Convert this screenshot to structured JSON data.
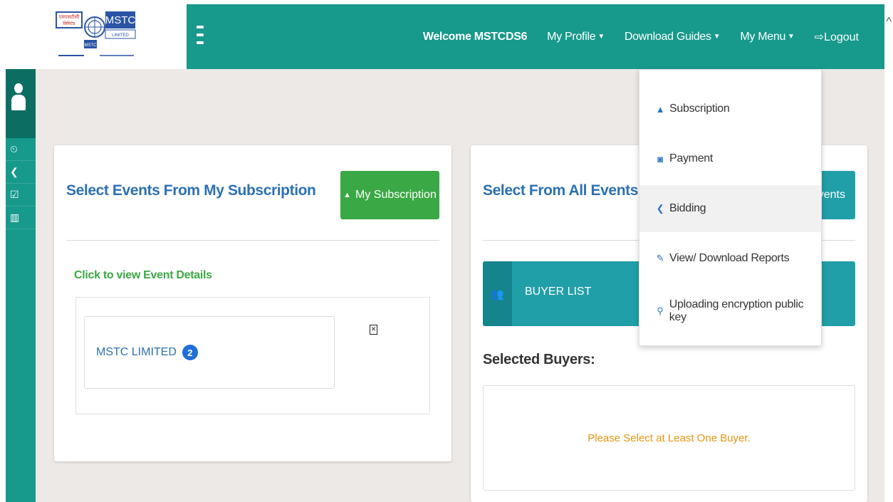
{
  "header": {
    "logo": {
      "hindi_text": "एमएसटीसी लिमिटेड",
      "brand": "MSTC",
      "sub": "LIMITED"
    },
    "welcome": "Welcome MSTCDS6",
    "nav": [
      {
        "label": "My Profile",
        "caret": "▼"
      },
      {
        "label": "Download Guides",
        "caret": "▼"
      },
      {
        "label": "My Menu",
        "caret": "▼"
      }
    ],
    "logout": "Logout",
    "logout_icon": "⮕"
  },
  "sidebar": {
    "items": [
      {
        "icon": "dashboard-icon",
        "glyph": "⏲"
      },
      {
        "icon": "gavel-icon",
        "glyph": "❮"
      },
      {
        "icon": "checkbox-icon",
        "glyph": "☑"
      },
      {
        "icon": "chart-icon",
        "glyph": "▥"
      }
    ]
  },
  "left_card": {
    "title": "Select Events From My Subscription",
    "button": {
      "label": "My Subscription",
      "icon_glyph": "🔔"
    },
    "green_label": "Click to view Event Details",
    "event": {
      "name": "MSTC LIMITED",
      "count": "2"
    },
    "close_glyph": "✕"
  },
  "right_card": {
    "title": "Select From All Events",
    "button_partial": "Events",
    "buyer_list": "BUYER LIST",
    "buyer_icon_glyph": "👥",
    "selected_buyers": "Selected Buyers:",
    "warning": "Please Select at Least One Buyer."
  },
  "dropdown": {
    "items": [
      {
        "label": "Subscription",
        "icon": "bell-icon",
        "glyph": "🔔"
      },
      {
        "label": "Payment",
        "icon": "payment-icon",
        "glyph": "▣"
      },
      {
        "label": "Bidding",
        "icon": "gavel-icon",
        "glyph": "❮"
      },
      {
        "label": "View/ Download Reports",
        "icon": "edit-icon",
        "glyph": "✎"
      },
      {
        "label": "Uploading encryption public key",
        "icon": "key-icon",
        "glyph": "⚲"
      }
    ]
  },
  "colors": {
    "primary_teal": "#17998b",
    "dark_teal": "#0c6e63",
    "title_blue": "#2d71b1",
    "green": "#3aa844",
    "button_teal": "#219fa8",
    "warning_orange": "#e8950f",
    "badge_blue": "#1f6fd6",
    "content_bg": "#ece9e7"
  }
}
